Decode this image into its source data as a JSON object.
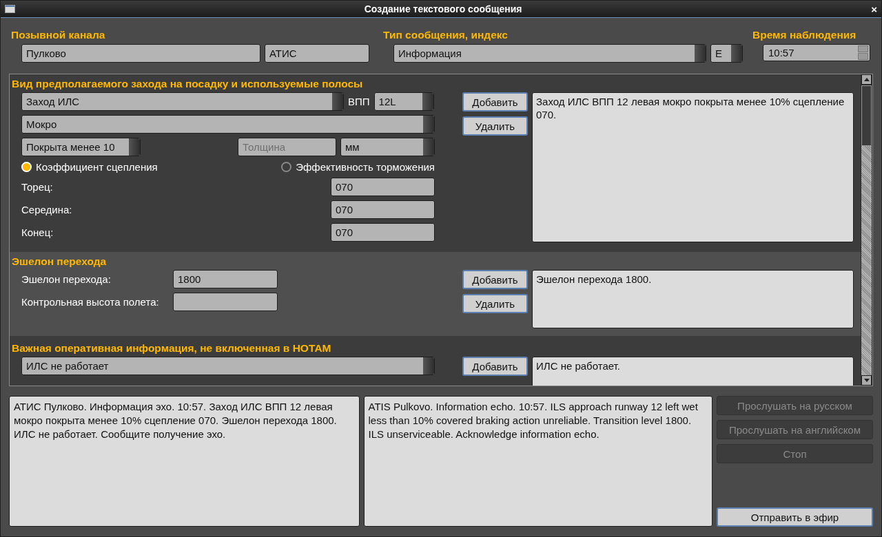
{
  "window": {
    "title": "Создание текстового сообщения",
    "close": "×"
  },
  "header": {
    "channel": {
      "label": "Позывной канала",
      "name": "Пулково",
      "type": "АТИС"
    },
    "message_type": {
      "label": "Тип сообщения, индекс",
      "type": "Информация",
      "index": "E"
    },
    "observation_time": {
      "label": "Время наблюдения",
      "value": "10:57"
    }
  },
  "sections": [
    {
      "kind": "runway",
      "title": "Вид предполагаемого захода на посадку и используемые полосы",
      "approach": "Заход ИЛС",
      "runway_label": "ВПП",
      "runway": "12L",
      "condition": "Мокро",
      "coverage": "Покрыта менее 10",
      "thickness": {
        "placeholder": "Толщина"
      },
      "unit": "мм",
      "modes": [
        {
          "label": "Коэффициент сцепления",
          "selected": true
        },
        {
          "label": "Эффективность торможения",
          "selected": false
        }
      ],
      "readings": [
        {
          "label": "Торец:",
          "value": "070"
        },
        {
          "label": "Середина:",
          "value": "070"
        },
        {
          "label": "Конец:",
          "value": "070"
        }
      ],
      "buttons": [
        "Добавить",
        "Удалить"
      ],
      "text": "Заход ИЛС ВПП 12 левая мокро покрыта менее 10% сцепление 070."
    },
    {
      "kind": "transition",
      "title": "Эшелон перехода",
      "fields": [
        {
          "label": "Эшелон перехода:",
          "value": "1800"
        },
        {
          "label": "Контрольная высота полета:"
        }
      ],
      "buttons": [
        "Добавить",
        "Удалить"
      ],
      "text": "Эшелон перехода 1800."
    },
    {
      "kind": "info",
      "title": "Важная оперативная информация, не включенная в НОТАМ",
      "selection": "ИЛС не работает",
      "buttons": [
        "Добавить"
      ],
      "text": "ИЛС не работает."
    }
  ],
  "bottom": {
    "russian_text": "АТИС Пулково. Информация эхо. 10:57. Заход ИЛС ВПП 12 левая мокро покрыта менее 10% сцепление 070. Эшелон перехода 1800. ИЛС не работает. Сообщите получение эхо.",
    "english_text": "ATIS Pulkovo. Information echo. 10:57. ILS approach runway 12 left wet less than 10% covered braking action unreliable. Transition level 1800. ILS unserviceable. Acknowledge information echo.",
    "actions": [
      {
        "label": "Прослушать на русском",
        "disabled": true
      },
      {
        "label": "Прослушать на английском",
        "disabled": true
      },
      {
        "label": "Стоп",
        "disabled": true
      }
    ],
    "send_button": {
      "label": "Отправить в эфир",
      "disabled": false
    }
  }
}
